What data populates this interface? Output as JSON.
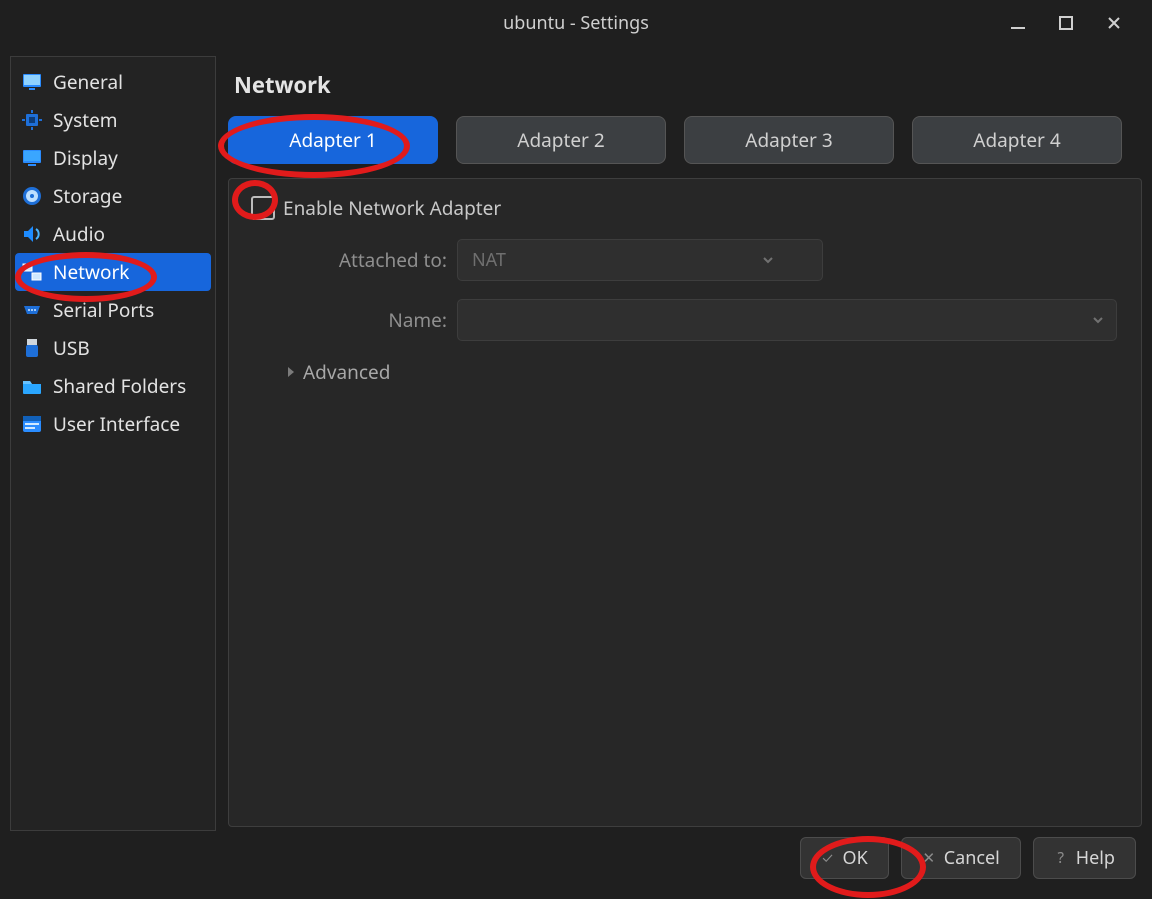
{
  "window": {
    "title": "ubuntu - Settings"
  },
  "sidebar": {
    "items": [
      {
        "label": "General",
        "icon": "monitor-icon",
        "active": false
      },
      {
        "label": "System",
        "icon": "chip-icon",
        "active": false
      },
      {
        "label": "Display",
        "icon": "display-icon",
        "active": false
      },
      {
        "label": "Storage",
        "icon": "disk-icon",
        "active": false
      },
      {
        "label": "Audio",
        "icon": "audio-icon",
        "active": false
      },
      {
        "label": "Network",
        "icon": "network-icon",
        "active": true
      },
      {
        "label": "Serial Ports",
        "icon": "serial-icon",
        "active": false
      },
      {
        "label": "USB",
        "icon": "usb-icon",
        "active": false
      },
      {
        "label": "Shared Folders",
        "icon": "folder-icon",
        "active": false
      },
      {
        "label": "User Interface",
        "icon": "ui-icon",
        "active": false
      }
    ]
  },
  "main": {
    "title": "Network",
    "tabs": [
      {
        "label": "Adapter 1",
        "active": true
      },
      {
        "label": "Adapter 2",
        "active": false
      },
      {
        "label": "Adapter 3",
        "active": false
      },
      {
        "label": "Adapter 4",
        "active": false
      }
    ],
    "enable_checkbox": {
      "label": "Enable Network Adapter",
      "checked": false
    },
    "attached_label": "Attached to:",
    "attached_value": "NAT",
    "name_label": "Name:",
    "name_value": "",
    "advanced_label": "Advanced"
  },
  "footer": {
    "ok": "OK",
    "cancel": "Cancel",
    "help": "Help"
  },
  "annotations": {
    "description": "Red hand-drawn ellipses highlighting: the Network sidebar item, the Adapter 1 tab, the Enable Network Adapter checkbox, and the OK button.",
    "targets": [
      "sidebar-item-network",
      "tab-adapter-1",
      "enable-network-checkbox",
      "ok-button"
    ]
  }
}
